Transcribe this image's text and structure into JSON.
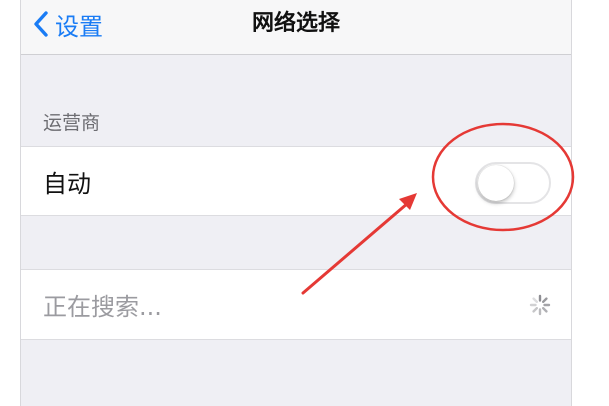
{
  "nav": {
    "back_label": "设置",
    "title": "网络选择"
  },
  "carrier_section": {
    "header": "运营商"
  },
  "auto_row": {
    "label": "自动",
    "toggle_on": false
  },
  "search_row": {
    "label": "正在搜索..."
  },
  "colors": {
    "accent": "#1a7cf5",
    "annotation": "#e53935",
    "background": "#efeff4"
  }
}
